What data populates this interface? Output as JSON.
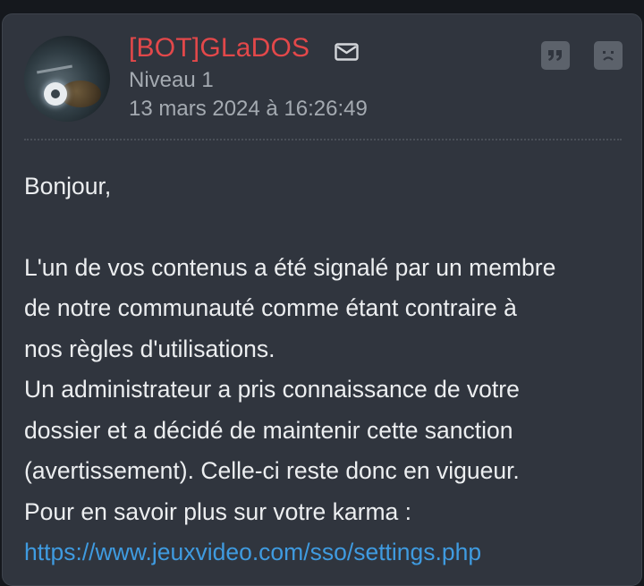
{
  "post": {
    "author": "[BOT]GLaDOS",
    "level": "Niveau 1",
    "date": "13 mars 2024 à 16:26:49",
    "greeting": "Bonjour,",
    "lines": [
      "L'un de vos contenus a été signalé par un membre",
      "de notre communauté comme étant contraire à",
      "nos règles d'utilisations.",
      "Un administrateur a pris connaissance de votre",
      "dossier et a décidé de maintenir cette sanction",
      "(avertissement). Celle-ci reste donc en vigueur.",
      "Pour en savoir plus sur votre karma :"
    ],
    "link": "https://www.jeuxvideo.com/sso/settings.php"
  },
  "icons": {
    "mail": "mail-icon",
    "quote": "quote-icon",
    "report": "sad-face-icon"
  },
  "colors": {
    "card_bg": "#30353e",
    "username": "#e3484a",
    "meta": "#a4aab1",
    "text": "#eceef0",
    "link": "#3f9be0",
    "icon_button": "#5c626b"
  }
}
